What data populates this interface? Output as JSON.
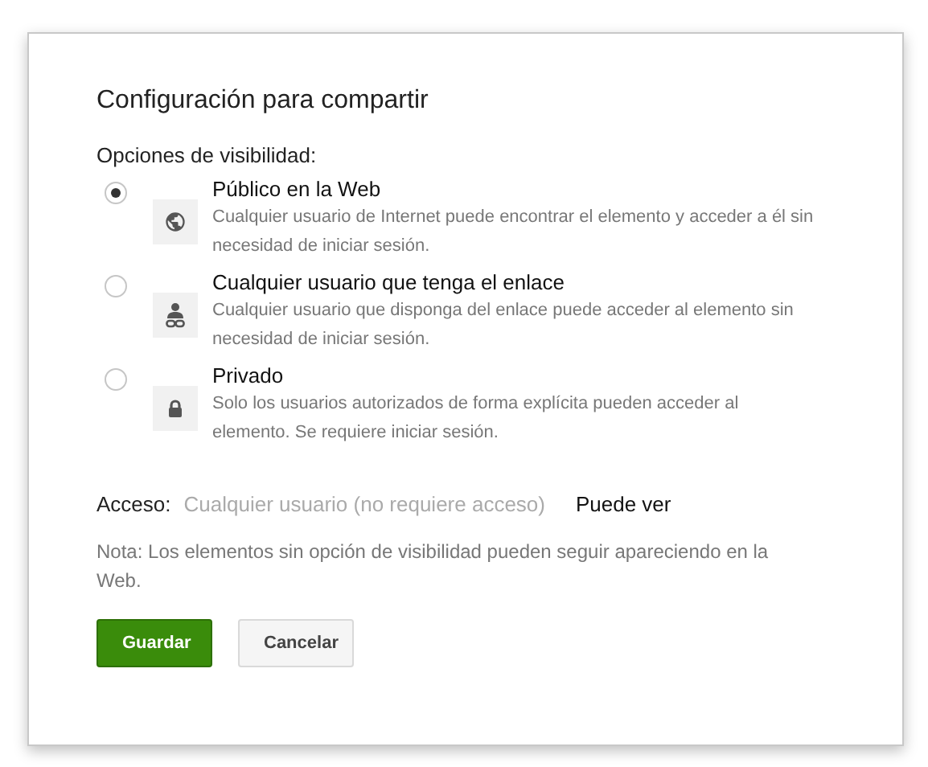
{
  "dialog": {
    "title": "Configuración para compartir",
    "visibility_label": "Opciones de visibilidad:",
    "options": [
      {
        "kind": "globe",
        "title": "Público en la Web",
        "description": "Cualquier usuario de Internet puede encontrar el elemento y acceder a él sin necesidad de iniciar sesión.",
        "selected": true
      },
      {
        "kind": "link",
        "title": "Cualquier usuario que tenga el enlace",
        "description": "Cualquier usuario que disponga del enlace puede acceder al elemento sin necesidad de iniciar sesión.",
        "selected": false
      },
      {
        "kind": "lock",
        "title": "Privado",
        "description": "Solo los usuarios autorizados de forma explícita pueden acceder al elemento. Se requiere iniciar sesión.",
        "selected": false
      }
    ],
    "access": {
      "label": "Acceso:",
      "value": "Cualquier usuario (no requiere acceso)",
      "permission": "Puede ver"
    },
    "note": "Nota: Los elementos sin opción de visibilidad pueden seguir apareciendo en la Web.",
    "buttons": [
      {
        "kind": "primary",
        "label": "Guardar"
      },
      {
        "kind": "secondary",
        "label": "Cancelar"
      }
    ]
  }
}
